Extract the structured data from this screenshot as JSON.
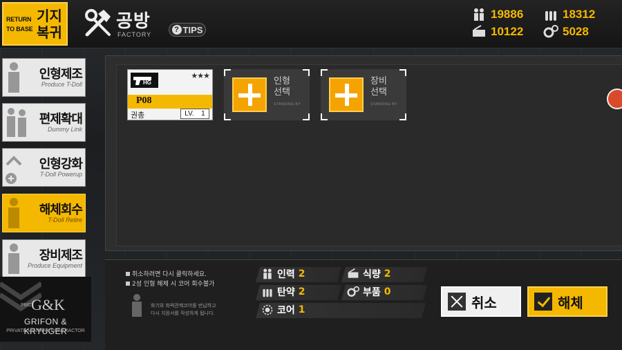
{
  "header": {
    "return_small_1": "RETURN",
    "return_small_2": "TO BASE",
    "return_big_1": "기지",
    "return_big_2": "복귀",
    "title": "공방",
    "subtitle": "FACTORY",
    "tips_label": "TIPS"
  },
  "resources": {
    "manpower": "19886",
    "ammo": "18312",
    "rations": "10122",
    "parts": "5028"
  },
  "sidebar": {
    "items": [
      {
        "ko": "인형제조",
        "en": "Produce T-Doll",
        "active": false
      },
      {
        "ko": "편제확대",
        "en": "Dummy Link",
        "active": false
      },
      {
        "ko": "인형강화",
        "en": "T-Doll Powerup",
        "active": false
      },
      {
        "ko": "해체회수",
        "en": "T-Doll Retire",
        "active": true
      },
      {
        "ko": "장비제조",
        "en": "Produce Equipment",
        "active": false
      }
    ],
    "logo": {
      "pmc": "PMC",
      "gk": "G&K",
      "name": "GRIFON & KRYUGER",
      "sub": "PRIVATE MILITARY CONTRACTOR"
    }
  },
  "doll_card": {
    "weapon_type": "HG",
    "stars": "★★★",
    "name": "P08",
    "type_label": "권총",
    "level_prefix": "LV.",
    "level": "1"
  },
  "slots": [
    {
      "label_1": "인형",
      "label_2": "선택",
      "standby": "STANDING BY"
    },
    {
      "label_1": "장비",
      "label_2": "선택",
      "standby": "STANDING BY"
    }
  ],
  "notes": {
    "line1": "취소하려면 다시 클릭하세요.",
    "line2": "2성 인형 해체 시 코어 회수불가",
    "hint1": "화기와 화력관제코어를 반납하고",
    "hint2": "다시 지원서를 작성하게 됩니다."
  },
  "costs": {
    "manpower_label": "인력",
    "manpower": "2",
    "rations_label": "식량",
    "rations": "2",
    "ammo_label": "탄약",
    "ammo": "2",
    "parts_label": "부품",
    "parts": "0",
    "core_label": "코어",
    "core": "1"
  },
  "buttons": {
    "cancel": "취소",
    "dismantle": "해체"
  },
  "colors": {
    "accent": "#f5b800",
    "panel": "#2e2e2e"
  }
}
